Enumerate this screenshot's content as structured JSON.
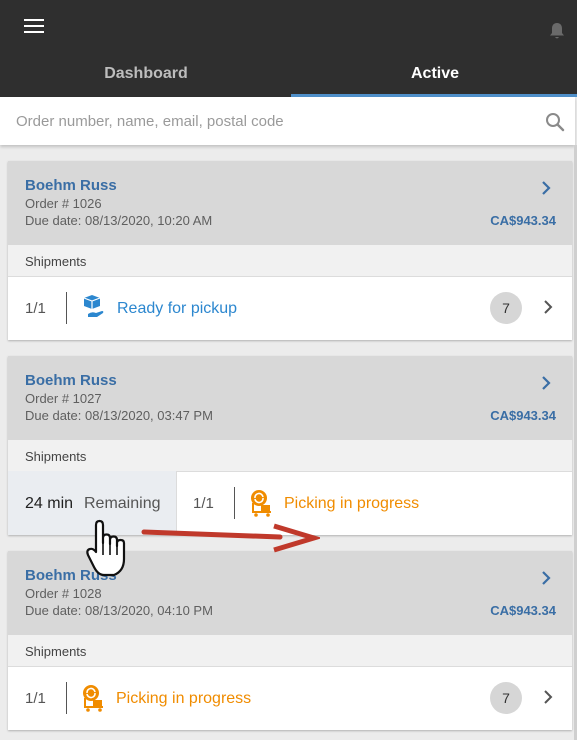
{
  "header": {
    "menu_icon": "hamburger-menu-icon",
    "notification_icon": "bell-icon",
    "tabs": [
      {
        "label": "Dashboard",
        "active": false
      },
      {
        "label": "Active",
        "active": true
      }
    ],
    "accent_color": "#4f8fc9"
  },
  "search": {
    "placeholder": "Order number, name, email, postal code",
    "value": ""
  },
  "orders": [
    {
      "customer": "Boehm Russ",
      "order_number": "Order # 1026",
      "due_date": "Due date: 08/13/2020, 10:20 AM",
      "amount": "CA$943.34",
      "shipments_label": "Shipments",
      "shipment": {
        "count": "1/1",
        "status": "Ready for pickup",
        "status_color": "#2c87cf",
        "badge": "7"
      }
    },
    {
      "customer": "Boehm Russ",
      "order_number": "Order # 1027",
      "due_date": "Due date: 08/13/2020, 03:47 PM",
      "amount": "CA$943.34",
      "shipments_label": "Shipments",
      "remaining": {
        "minutes": "24 min",
        "label": "Remaining"
      },
      "shipment": {
        "count": "1/1",
        "status": "Picking in progress",
        "status_color": "#f08c00"
      }
    },
    {
      "customer": "Boehm Russ",
      "order_number": "Order # 1028",
      "due_date": "Due date: 08/13/2020, 04:10 PM",
      "amount": "CA$943.34",
      "shipments_label": "Shipments",
      "shipment": {
        "count": "1/1",
        "status": "Picking in progress",
        "status_color": "#f08c00",
        "badge": "7"
      }
    }
  ],
  "gesture_overlay": {
    "icon": "hand-cursor-icon",
    "arrow": "swipe-right-arrow-icon",
    "arrow_color": "#c0392b"
  }
}
